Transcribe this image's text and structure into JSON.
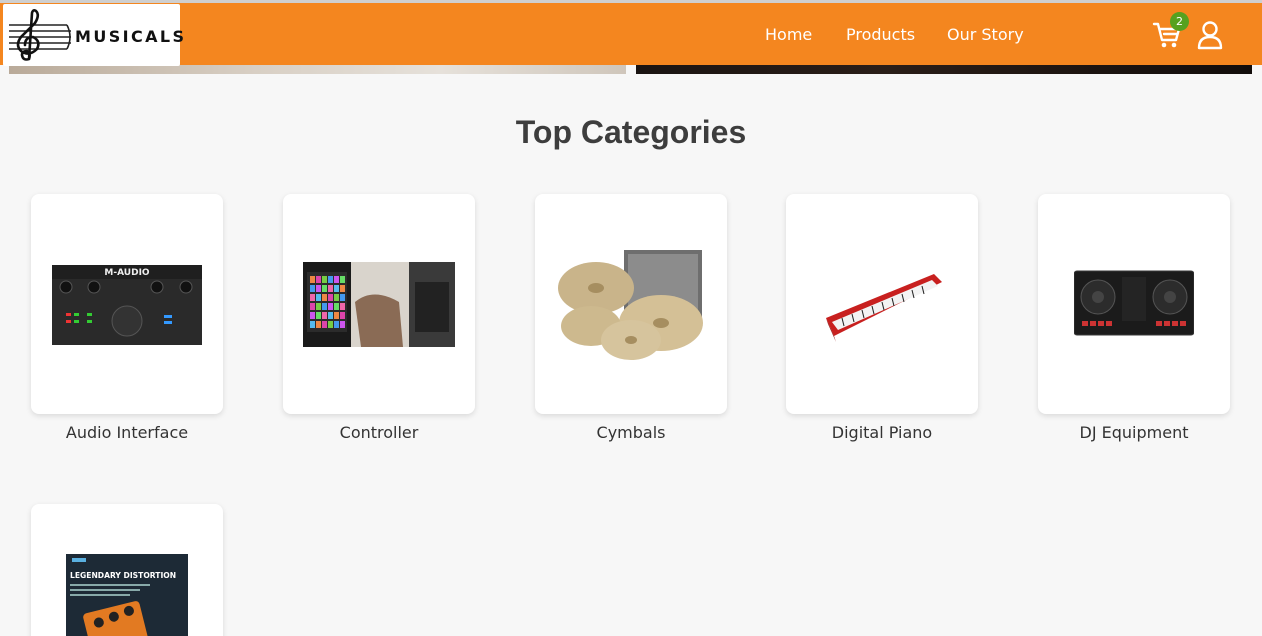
{
  "brand": {
    "name": "MUSICALS"
  },
  "nav": {
    "home": "Home",
    "products": "Products",
    "story": "Our Story"
  },
  "cart": {
    "count": "2"
  },
  "section": {
    "title": "Top Categories"
  },
  "categories": [
    {
      "label": "Audio Interface",
      "thumb_text": "M-AUDIO"
    },
    {
      "label": "Controller"
    },
    {
      "label": "Cymbals"
    },
    {
      "label": "Digital Piano"
    },
    {
      "label": "DJ Equipment"
    },
    {
      "label": "",
      "thumb_text": "LEGENDARY DISTORTION"
    }
  ],
  "colors": {
    "header": "#f4861f",
    "badge": "#56a11f",
    "background": "#f7f7f7"
  },
  "icons": [
    "treble-clef-icon",
    "cart-icon",
    "user-icon"
  ]
}
